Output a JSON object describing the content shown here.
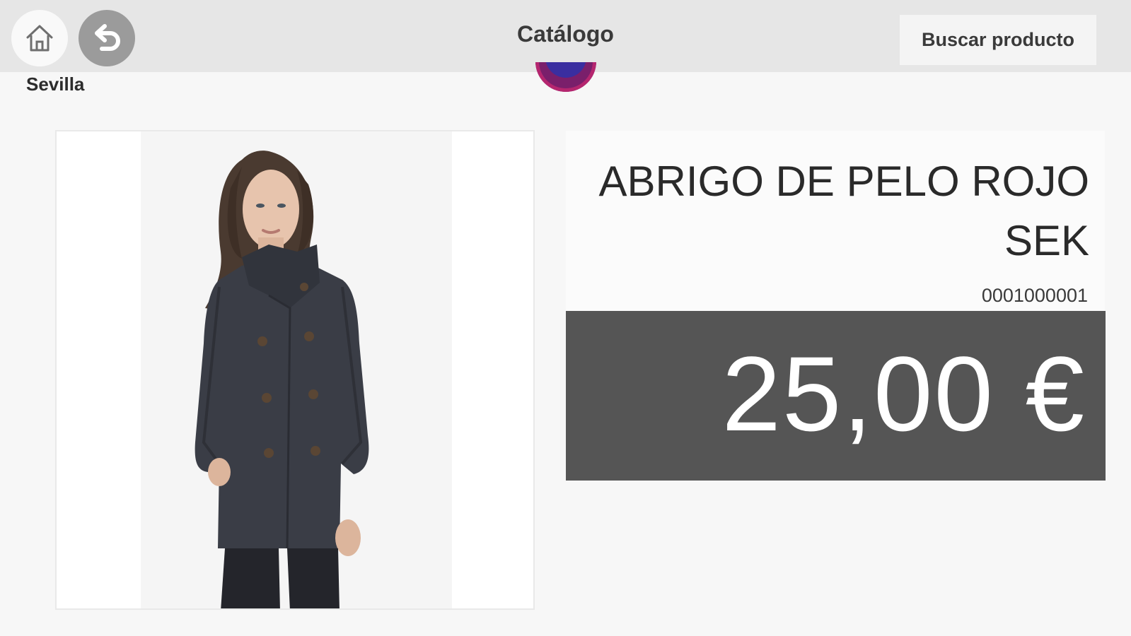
{
  "header": {
    "title": "Catálogo",
    "search_label": "Buscar producto",
    "home_icon": "home-icon",
    "back_icon": "back-arrow-icon"
  },
  "store": {
    "name": "Sevilla",
    "logo_icon": "store-logo"
  },
  "product": {
    "name": "ABRIGO DE PELO ROJO SEK",
    "code": "0001000001",
    "price": "25,00 €",
    "image_icon": "product-photo-coat"
  },
  "colors": {
    "topbar": "#e6e6e6",
    "back_button": "#9b9b9b",
    "price_background": "#555555",
    "price_text": "#ffffff",
    "logo": "#7a1f6b"
  }
}
